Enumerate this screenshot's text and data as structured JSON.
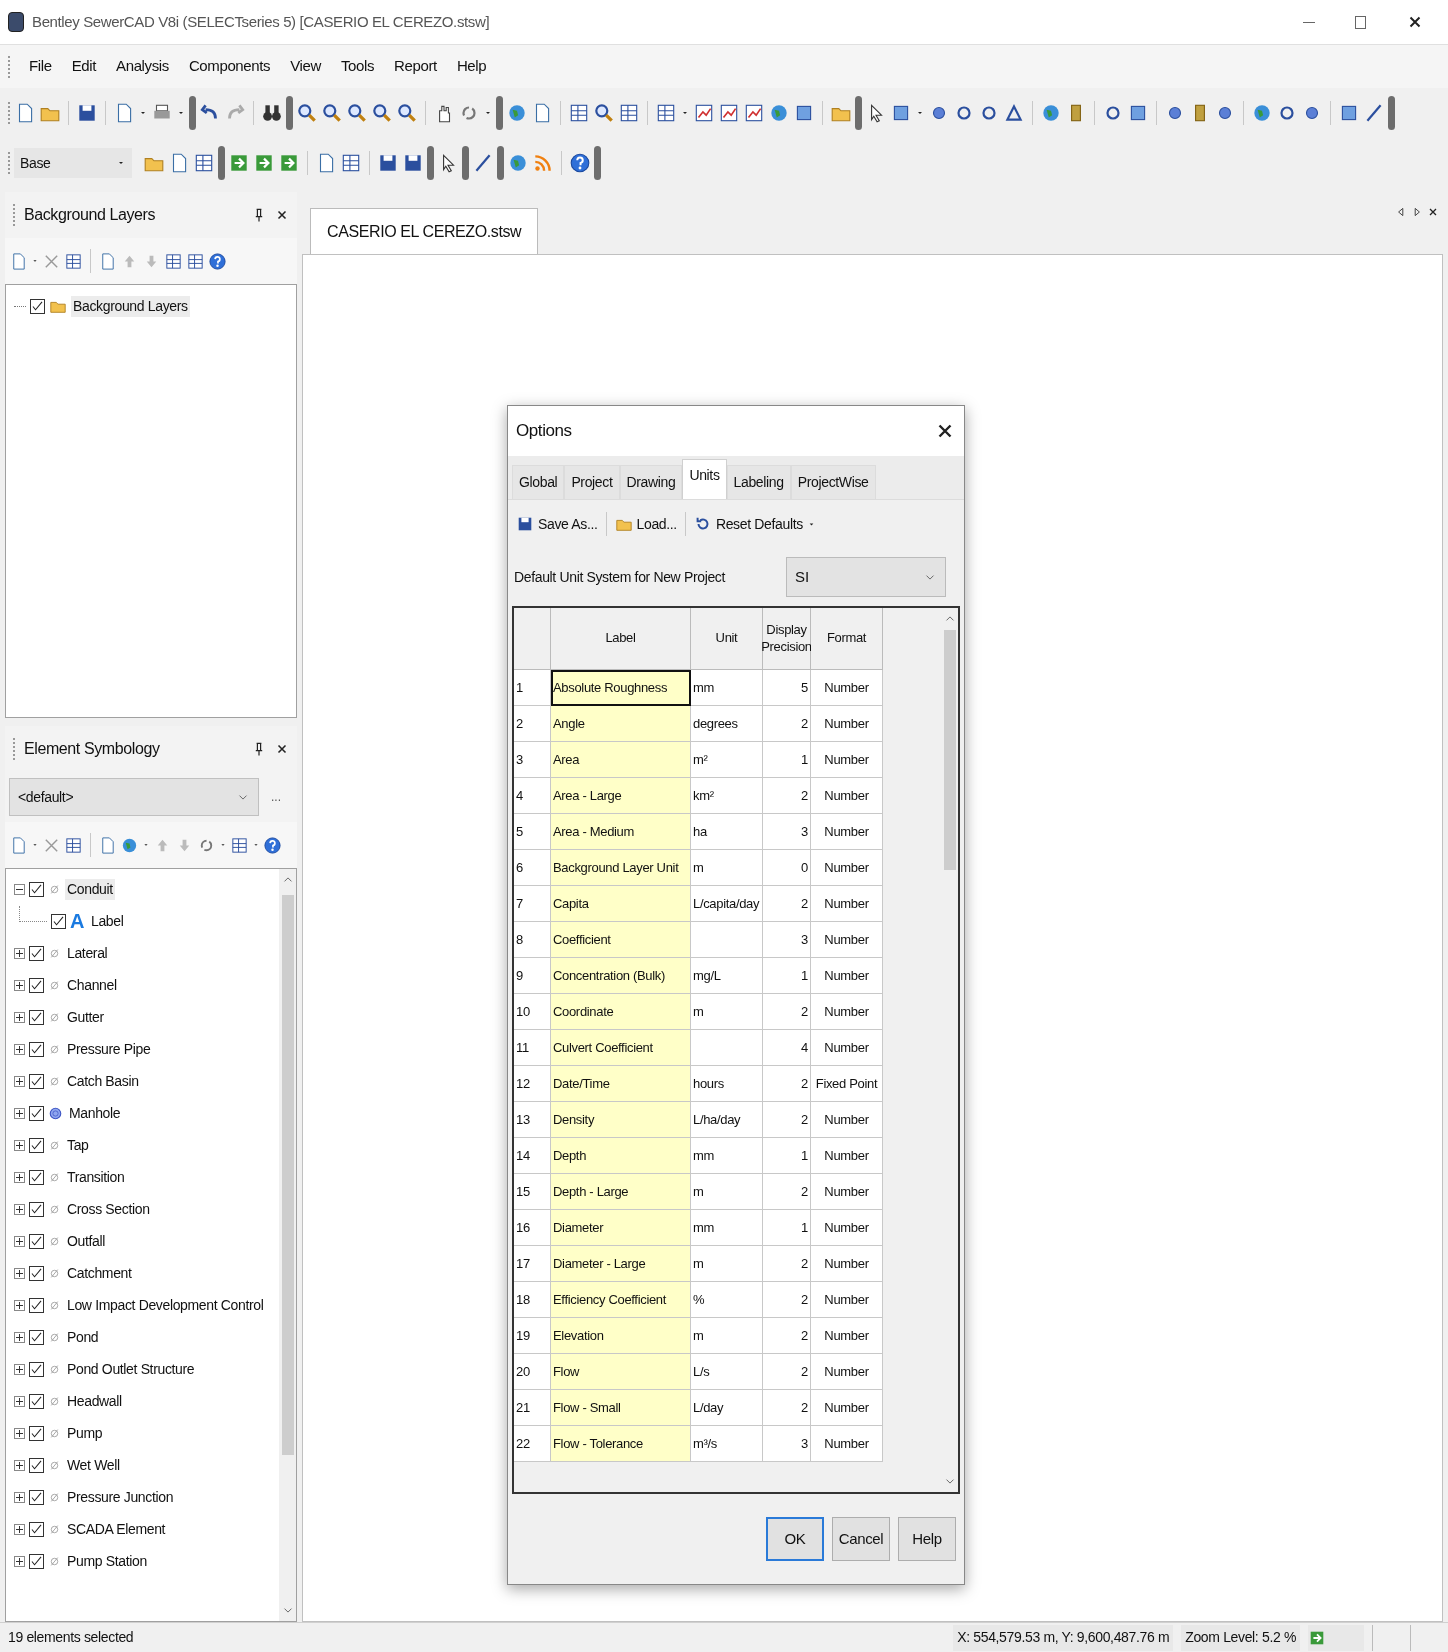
{
  "window": {
    "title": "Bentley SewerCAD V8i (SELECTseries 5) [CASERIO EL CEREZO.stsw]"
  },
  "menu": [
    "File",
    "Edit",
    "Analysis",
    "Components",
    "View",
    "Tools",
    "Report",
    "Help"
  ],
  "toolbar": {
    "layer_select": "Base"
  },
  "background_layers": {
    "title": "Background Layers",
    "tree": [
      {
        "label": "Background Layers",
        "checked": true,
        "selected": true
      }
    ]
  },
  "element_symbology": {
    "title": "Element Symbology",
    "select": "<default>",
    "more": "...",
    "tree": [
      {
        "label": "Conduit",
        "checked": true,
        "expanded": true,
        "kind": "none",
        "selected": true,
        "children": [
          {
            "label": "Label",
            "checked": true,
            "kind": "label",
            "glyph": "A",
            "selected": false
          }
        ]
      },
      {
        "label": "Lateral",
        "checked": true,
        "expanded": false,
        "kind": "none",
        "selected": false
      },
      {
        "label": "Channel",
        "checked": true,
        "expanded": false,
        "kind": "none",
        "selected": false
      },
      {
        "label": "Gutter",
        "checked": true,
        "expanded": false,
        "kind": "none",
        "selected": false
      },
      {
        "label": "Pressure Pipe",
        "checked": true,
        "expanded": false,
        "kind": "none",
        "selected": false
      },
      {
        "label": "Catch Basin",
        "checked": true,
        "expanded": false,
        "kind": "none",
        "selected": false
      },
      {
        "label": "Manhole",
        "checked": true,
        "expanded": false,
        "kind": "node",
        "selected": false
      },
      {
        "label": "Tap",
        "checked": true,
        "expanded": false,
        "kind": "none",
        "selected": false
      },
      {
        "label": "Transition",
        "checked": true,
        "expanded": false,
        "kind": "none",
        "selected": false
      },
      {
        "label": "Cross Section",
        "checked": true,
        "expanded": false,
        "kind": "none",
        "selected": false
      },
      {
        "label": "Outfall",
        "checked": true,
        "expanded": false,
        "kind": "none",
        "selected": false
      },
      {
        "label": "Catchment",
        "checked": true,
        "expanded": false,
        "kind": "none",
        "selected": false
      },
      {
        "label": "Low Impact Development Control",
        "checked": true,
        "expanded": false,
        "kind": "none",
        "selected": false
      },
      {
        "label": "Pond",
        "checked": true,
        "expanded": false,
        "kind": "none",
        "selected": false
      },
      {
        "label": "Pond Outlet Structure",
        "checked": true,
        "expanded": false,
        "kind": "none",
        "selected": false
      },
      {
        "label": "Headwall",
        "checked": true,
        "expanded": false,
        "kind": "none",
        "selected": false
      },
      {
        "label": "Pump",
        "checked": true,
        "expanded": false,
        "kind": "none",
        "selected": false
      },
      {
        "label": "Wet Well",
        "checked": true,
        "expanded": false,
        "kind": "none",
        "selected": false
      },
      {
        "label": "Pressure Junction",
        "checked": true,
        "expanded": false,
        "kind": "none",
        "selected": false
      },
      {
        "label": "SCADA Element",
        "checked": true,
        "expanded": false,
        "kind": "none",
        "selected": false
      },
      {
        "label": "Pump Station",
        "checked": true,
        "expanded": false,
        "kind": "none",
        "selected": false
      }
    ]
  },
  "document_tab": {
    "label": "CASERIO EL CEREZO.stsw"
  },
  "dialog": {
    "title": "Options",
    "tabs": [
      {
        "label": "Global",
        "selected": false
      },
      {
        "label": "Project",
        "selected": false
      },
      {
        "label": "Drawing",
        "selected": false
      },
      {
        "label": "Units",
        "selected": true
      },
      {
        "label": "Labeling",
        "selected": false
      },
      {
        "label": "ProjectWise",
        "selected": false
      }
    ],
    "actions": [
      "Save As...",
      "Load...",
      "Reset Defaults"
    ],
    "unit_system": {
      "label": "Default Unit System for New Project",
      "value": "SI"
    },
    "table": {
      "columns": [
        "Label",
        "Unit",
        "Display Precision",
        "Format"
      ],
      "rows": [
        {
          "index": "1",
          "label": "Absolute Roughness",
          "unit": "mm",
          "precision": "5",
          "format": "Number",
          "selected": true
        },
        {
          "index": "2",
          "label": "Angle",
          "unit": "degrees",
          "precision": "2",
          "format": "Number",
          "selected": false
        },
        {
          "index": "3",
          "label": "Area",
          "unit": "m²",
          "precision": "1",
          "format": "Number",
          "selected": false
        },
        {
          "index": "4",
          "label": "Area - Large",
          "unit": "km²",
          "precision": "2",
          "format": "Number",
          "selected": false
        },
        {
          "index": "5",
          "label": "Area - Medium",
          "unit": "ha",
          "precision": "3",
          "format": "Number",
          "selected": false
        },
        {
          "index": "6",
          "label": "Background Layer Unit",
          "unit": "m",
          "precision": "0",
          "format": "Number",
          "selected": false
        },
        {
          "index": "7",
          "label": "Capita",
          "unit": "L/capita/day",
          "precision": "2",
          "format": "Number",
          "selected": false
        },
        {
          "index": "8",
          "label": "Coefficient",
          "unit": "",
          "precision": "3",
          "format": "Number",
          "selected": false
        },
        {
          "index": "9",
          "label": "Concentration (Bulk)",
          "unit": "mg/L",
          "precision": "1",
          "format": "Number",
          "selected": false
        },
        {
          "index": "10",
          "label": "Coordinate",
          "unit": "m",
          "precision": "2",
          "format": "Number",
          "selected": false
        },
        {
          "index": "11",
          "label": "Culvert Coefficient",
          "unit": "",
          "precision": "4",
          "format": "Number",
          "selected": false
        },
        {
          "index": "12",
          "label": "Date/Time",
          "unit": "hours",
          "precision": "2",
          "format": "Fixed Point",
          "selected": false
        },
        {
          "index": "13",
          "label": "Density",
          "unit": "L/ha/day",
          "precision": "2",
          "format": "Number",
          "selected": false
        },
        {
          "index": "14",
          "label": "Depth",
          "unit": "mm",
          "precision": "1",
          "format": "Number",
          "selected": false
        },
        {
          "index": "15",
          "label": "Depth - Large",
          "unit": "m",
          "precision": "2",
          "format": "Number",
          "selected": false
        },
        {
          "index": "16",
          "label": "Diameter",
          "unit": "mm",
          "precision": "1",
          "format": "Number",
          "selected": false
        },
        {
          "index": "17",
          "label": "Diameter - Large",
          "unit": "m",
          "precision": "2",
          "format": "Number",
          "selected": false
        },
        {
          "index": "18",
          "label": "Efficiency Coefficient",
          "unit": "%",
          "precision": "2",
          "format": "Number",
          "selected": false
        },
        {
          "index": "19",
          "label": "Elevation",
          "unit": "m",
          "precision": "2",
          "format": "Number",
          "selected": false
        },
        {
          "index": "20",
          "label": "Flow",
          "unit": "L/s",
          "precision": "2",
          "format": "Number",
          "selected": false
        },
        {
          "index": "21",
          "label": "Flow - Small",
          "unit": "L/day",
          "precision": "2",
          "format": "Number",
          "selected": false
        },
        {
          "index": "22",
          "label": "Flow - Tolerance",
          "unit": "m³/s",
          "precision": "3",
          "format": "Number",
          "selected": false
        }
      ]
    },
    "buttons": [
      {
        "label": "OK",
        "default": true
      },
      {
        "label": "Cancel",
        "default": false
      },
      {
        "label": "Help",
        "default": false
      }
    ]
  },
  "status_bar": {
    "selection": "19 elements selected",
    "coordinates": "X: 554,579.53 m, Y: 9,600,487.76 m",
    "zoom": "Zoom Level: 5.2 %"
  }
}
